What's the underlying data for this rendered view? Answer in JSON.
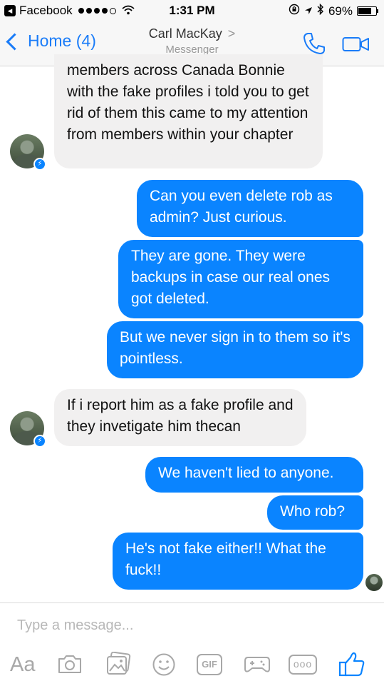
{
  "status_bar": {
    "back_app": "Facebook",
    "time": "1:31 PM",
    "battery": "69%"
  },
  "nav": {
    "back_label": "Home (4)",
    "contact_name": "Carl MacKay",
    "subtitle": "Messenger"
  },
  "messages": [
    {
      "sender": "contact",
      "text": "members across Canada  Bonnie with the fake profiles   i told you to get rid of them  this came to my attention from members within your chapter"
    },
    {
      "sender": "me",
      "text": "Can you even delete rob as admin? Just curious."
    },
    {
      "sender": "me",
      "text": "They are gone. They were backups in case our real ones got deleted."
    },
    {
      "sender": "me",
      "text": "But we never sign in to them so it's pointless."
    },
    {
      "sender": "contact",
      "text": "If i report him as a fake profile and they invetigate him thecan"
    },
    {
      "sender": "me",
      "text": "We haven't lied to anyone."
    },
    {
      "sender": "me",
      "text": "Who rob?"
    },
    {
      "sender": "me",
      "text": "He's not fake either!! What the fuck!!"
    }
  ],
  "composer": {
    "placeholder": "Type a message...",
    "aa_label": "Aa",
    "gif_label": "GIF",
    "more_label": "ooo"
  },
  "colors": {
    "accent": "#0a84ff",
    "incoming_bubble": "#f1f0f0",
    "nav_blue": "#1a7cf8"
  }
}
